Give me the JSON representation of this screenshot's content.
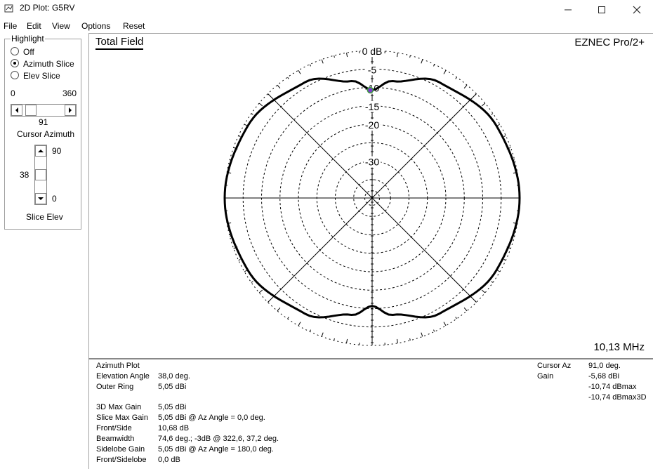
{
  "window": {
    "title": "2D Plot: G5RV"
  },
  "menu": [
    "File",
    "Edit",
    "View",
    "Options",
    "Reset"
  ],
  "highlight": {
    "legend": "Highlight",
    "options": [
      {
        "label": "Off",
        "checked": false
      },
      {
        "label": "Azimuth Slice",
        "checked": true
      },
      {
        "label": "Elev Slice",
        "checked": false
      }
    ],
    "az_min": "0",
    "az_max": "360",
    "az_value": "91",
    "az_label": "Cursor Azimuth",
    "elev_max": "90",
    "elev_value": "38",
    "elev_min": "0",
    "elev_label": "Slice Elev"
  },
  "plot": {
    "title": "Total Field",
    "brand": "EZNEC Pro/2+",
    "frequency": "10,13 MHz",
    "ring_labels": [
      "0 dB",
      "-5",
      "-10",
      "-15",
      "-20",
      "-30"
    ]
  },
  "chart_data": {
    "type": "polar",
    "title": "Total Field",
    "radial_unit": "dB",
    "rings_db": [
      0,
      -5,
      -10,
      -15,
      -20,
      -30
    ],
    "outer_ring_dbi": 5.05,
    "gain_db_by_azimuth_deg": {
      "0": 0,
      "30": -1.0,
      "60": -3.7,
      "80": -7.8,
      "90": -10.7,
      "100": -7.8,
      "120": -3.7,
      "150": -1.0,
      "180": 0,
      "210": -1.0,
      "240": -3.7,
      "260": -7.8,
      "270": -10.7,
      "280": -7.8,
      "300": -3.7,
      "330": -1.0
    },
    "cursor": {
      "azimuth_deg": 91.0,
      "gain_dbmax": -10.74
    }
  },
  "info": {
    "left": [
      {
        "k": "Azimuth Plot",
        "v": ""
      },
      {
        "k": "Elevation Angle",
        "v": "38,0 deg."
      },
      {
        "k": "Outer Ring",
        "v": "5,05 dBi"
      },
      {
        "k": "3D Max Gain",
        "v": "5,05 dBi"
      },
      {
        "k": "Slice Max Gain",
        "v": "5,05 dBi @ Az Angle = 0,0 deg."
      },
      {
        "k": "Front/Side",
        "v": "10,68 dB"
      },
      {
        "k": "Beamwidth",
        "v": "74,6 deg.; -3dB @ 322,6, 37,2 deg."
      },
      {
        "k": "Sidelobe Gain",
        "v": "5,05 dBi @ Az Angle = 180,0 deg."
      },
      {
        "k": "Front/Sidelobe",
        "v": "0,0 dB"
      }
    ],
    "right": {
      "cursor_az_label": "Cursor Az",
      "cursor_az_value": "91,0 deg.",
      "gain_label": "Gain",
      "gain_values": [
        "-5,68 dBi",
        "-10,74 dBmax",
        "-10,74 dBmax3D"
      ]
    }
  }
}
